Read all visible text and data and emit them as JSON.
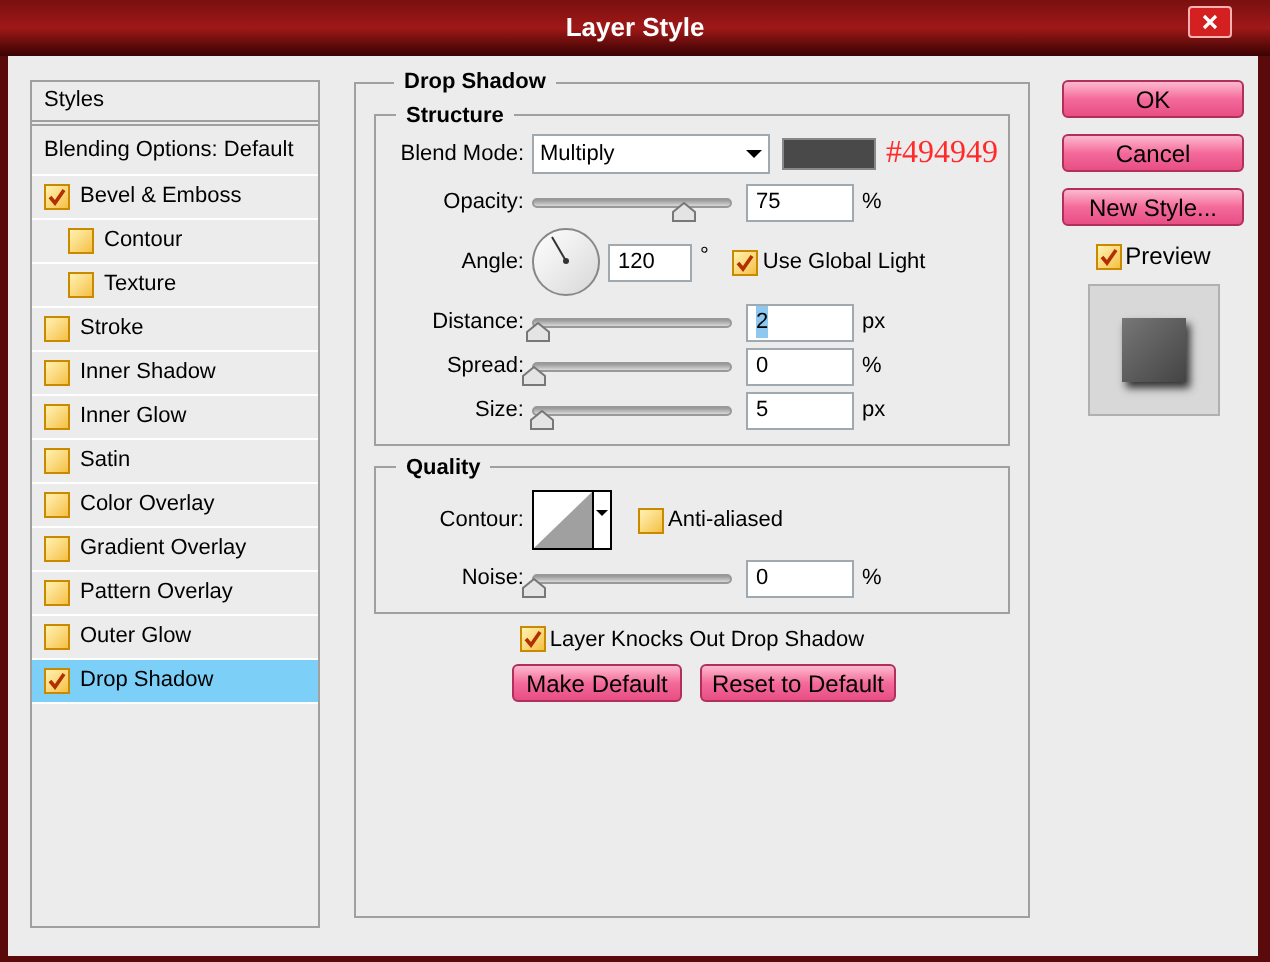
{
  "window": {
    "title": "Layer Style"
  },
  "styles_panel": {
    "header": "Styles",
    "items": [
      {
        "label": "Blending Options: Default",
        "kind": "plain",
        "selected": false
      },
      {
        "label": "Bevel & Emboss",
        "kind": "check",
        "checked": true,
        "selected": false,
        "children": [
          {
            "label": "Contour",
            "kind": "check",
            "checked": false,
            "selected": false
          },
          {
            "label": "Texture",
            "kind": "check",
            "checked": false,
            "selected": false
          }
        ]
      },
      {
        "label": "Stroke",
        "kind": "check",
        "checked": false,
        "selected": false
      },
      {
        "label": "Inner Shadow",
        "kind": "check",
        "checked": false,
        "selected": false
      },
      {
        "label": "Inner Glow",
        "kind": "check",
        "checked": false,
        "selected": false
      },
      {
        "label": "Satin",
        "kind": "check",
        "checked": false,
        "selected": false
      },
      {
        "label": "Color Overlay",
        "kind": "check",
        "checked": false,
        "selected": false
      },
      {
        "label": "Gradient Overlay",
        "kind": "check",
        "checked": false,
        "selected": false
      },
      {
        "label": "Pattern Overlay",
        "kind": "check",
        "checked": false,
        "selected": false
      },
      {
        "label": "Outer Glow",
        "kind": "check",
        "checked": false,
        "selected": false
      },
      {
        "label": "Drop Shadow",
        "kind": "check",
        "checked": true,
        "selected": true
      }
    ]
  },
  "drop_shadow": {
    "title": "Drop Shadow",
    "structure": {
      "title": "Structure",
      "rows": [
        {
          "kind": "blend",
          "label": "Blend Mode:",
          "value": "Multiply",
          "color": "#494949",
          "annotation": "#494949"
        },
        {
          "kind": "slider",
          "label": "Opacity:",
          "level": 0.77,
          "value": "75",
          "unit": "%"
        },
        {
          "kind": "angle",
          "label": "Angle:",
          "value": "120",
          "unit": "°",
          "check_label": "Use Global Light",
          "checked": true
        },
        {
          "kind": "slider",
          "label": "Distance:",
          "level": 0.02,
          "value": "2",
          "unit": "px",
          "focused": true
        },
        {
          "kind": "slider",
          "label": "Spread:",
          "level": 0,
          "value": "0",
          "unit": "%"
        },
        {
          "kind": "slider",
          "label": "Size:",
          "level": 0.04,
          "value": "5",
          "unit": "px"
        }
      ]
    },
    "quality": {
      "title": "Quality",
      "rows": [
        {
          "kind": "contour",
          "label": "Contour:",
          "check_label": "Anti-aliased",
          "checked": false
        },
        {
          "kind": "slider",
          "label": "Noise:",
          "level": 0,
          "value": "0",
          "unit": "%"
        }
      ]
    },
    "knockout": {
      "label": "Layer Knocks Out Drop Shadow",
      "checked": true
    },
    "buttons": [
      "Make Default",
      "Reset to Default"
    ]
  },
  "actions": {
    "buttons": [
      "OK",
      "Cancel",
      "New Style..."
    ],
    "preview": {
      "label": "Preview",
      "checked": true
    }
  }
}
